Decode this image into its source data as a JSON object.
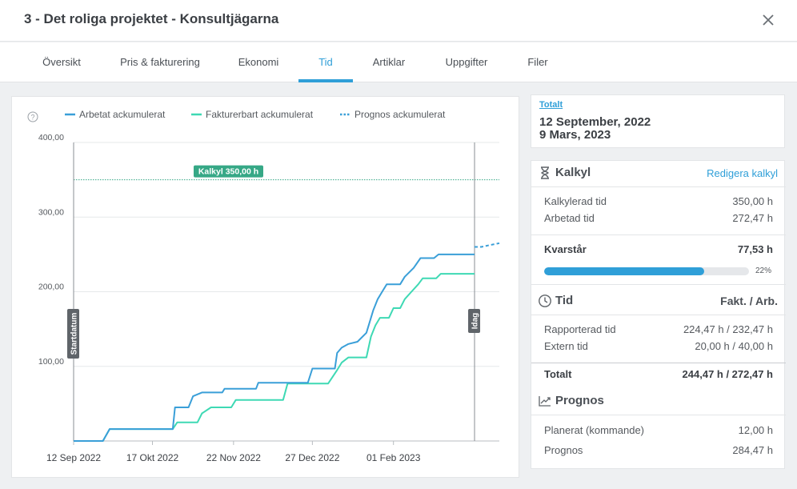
{
  "header": {
    "title": "3 - Det roliga projektet - Konsultjägarna"
  },
  "tabs": [
    {
      "label": "Översikt"
    },
    {
      "label": "Pris & fakturering"
    },
    {
      "label": "Ekonomi"
    },
    {
      "label": "Tid"
    },
    {
      "label": "Artiklar"
    },
    {
      "label": "Uppgifter"
    },
    {
      "label": "Filer"
    }
  ],
  "active_tab": "Tid",
  "summary": {
    "link": "Totalt",
    "start_date": "12 September, 2022",
    "end_date": "9 Mars, 2023"
  },
  "kalkyl": {
    "title": "Kalkyl",
    "edit_link": "Redigera kalkyl",
    "rows": [
      {
        "label": "Kalkylerad tid",
        "value": "350,00 h"
      },
      {
        "label": "Arbetad tid",
        "value": "272,47 h"
      }
    ],
    "remaining": {
      "label": "Kvarstår",
      "value": "77,53 h"
    },
    "progress_fraction": 0.78,
    "progress_label": "22%"
  },
  "tid": {
    "title": "Tid",
    "columns": "Fakt. / Arb.",
    "rows": [
      {
        "label": "Rapporterad tid",
        "value": "224,47 h / 232,47 h"
      },
      {
        "label": "Extern tid",
        "value": "20,00 h / 40,00 h"
      }
    ],
    "total": {
      "label": "Totalt",
      "value": "244,47 h / 272,47 h"
    }
  },
  "prognos": {
    "title": "Prognos",
    "rows": [
      {
        "label": "Planerat (kommande)",
        "value": "12,00 h"
      },
      {
        "label": "Prognos",
        "value": "284,47 h"
      }
    ]
  },
  "colors": {
    "accent": "#2f9fd8",
    "arbetat": "#3a9fd8",
    "fakturerbart": "#3ed9b4",
    "prognos": "#3a9fd8",
    "kalkyl": "#36a886"
  },
  "chart_data": {
    "type": "line",
    "legend": [
      {
        "name": "Arbetat ackumulerat",
        "style": "solid"
      },
      {
        "name": "Fakturerbart ackumulerat",
        "style": "solid"
      },
      {
        "name": "Prognos ackumulerat",
        "style": "dotted"
      }
    ],
    "ylim": [
      0,
      400
    ],
    "yticks": [
      "100,00",
      "200,00",
      "300,00",
      "400,00"
    ],
    "yvalues": [
      100,
      200,
      300,
      400
    ],
    "xlim": [
      "2022-09-12",
      "2023-03-20"
    ],
    "xticks": [
      {
        "label": "12 Sep 2022",
        "date": "2022-09-12"
      },
      {
        "label": "17 Okt 2022",
        "date": "2022-10-17"
      },
      {
        "label": "22 Nov 2022",
        "date": "2022-11-22"
      },
      {
        "label": "27 Dec 2022",
        "date": "2022-12-27"
      },
      {
        "label": "01 Feb 2023",
        "date": "2023-02-01"
      }
    ],
    "kalkyl_line": {
      "value": 350,
      "label": "Kalkyl 350,00 h"
    },
    "markers": [
      {
        "date": "2022-09-12",
        "label": "Startdatum"
      },
      {
        "date": "2023-03-09",
        "label": "Idag"
      }
    ],
    "series": [
      {
        "name": "Arbetat ackumulerat",
        "points": [
          [
            "2022-09-12",
            0
          ],
          [
            "2022-09-25",
            0
          ],
          [
            "2022-09-28",
            16
          ],
          [
            "2022-10-16",
            16
          ],
          [
            "2022-10-26",
            16
          ],
          [
            "2022-10-27",
            45
          ],
          [
            "2022-11-02",
            45
          ],
          [
            "2022-11-04",
            60
          ],
          [
            "2022-11-08",
            65
          ],
          [
            "2022-11-17",
            65
          ],
          [
            "2022-11-18",
            70
          ],
          [
            "2022-12-02",
            70
          ],
          [
            "2022-12-03",
            78
          ],
          [
            "2022-12-25",
            78
          ],
          [
            "2022-12-27",
            97
          ],
          [
            "2023-01-06",
            97
          ],
          [
            "2023-01-07",
            118
          ],
          [
            "2023-01-09",
            125
          ],
          [
            "2023-01-12",
            130
          ],
          [
            "2023-01-16",
            133
          ],
          [
            "2023-01-20",
            145
          ],
          [
            "2023-01-22",
            165
          ],
          [
            "2023-01-23",
            175
          ],
          [
            "2023-01-25",
            190
          ],
          [
            "2023-01-27",
            200
          ],
          [
            "2023-01-29",
            210
          ],
          [
            "2023-02-04",
            210
          ],
          [
            "2023-02-06",
            220
          ],
          [
            "2023-02-10",
            232
          ],
          [
            "2023-02-13",
            245
          ],
          [
            "2023-02-19",
            245
          ],
          [
            "2023-02-21",
            250
          ],
          [
            "2023-03-09",
            250
          ]
        ]
      },
      {
        "name": "Fakturerbart ackumulerat",
        "points": [
          [
            "2022-09-12",
            0
          ],
          [
            "2022-09-25",
            0
          ],
          [
            "2022-09-28",
            16
          ],
          [
            "2022-10-26",
            16
          ],
          [
            "2022-10-28",
            25
          ],
          [
            "2022-11-06",
            25
          ],
          [
            "2022-11-08",
            37
          ],
          [
            "2022-11-12",
            45
          ],
          [
            "2022-11-21",
            45
          ],
          [
            "2022-11-23",
            55
          ],
          [
            "2022-12-14",
            55
          ],
          [
            "2022-12-16",
            77
          ],
          [
            "2023-01-03",
            77
          ],
          [
            "2023-01-07",
            95
          ],
          [
            "2023-01-09",
            105
          ],
          [
            "2023-01-12",
            112
          ],
          [
            "2023-01-20",
            112
          ],
          [
            "2023-01-22",
            140
          ],
          [
            "2023-01-24",
            155
          ],
          [
            "2023-01-26",
            165
          ],
          [
            "2023-01-30",
            165
          ],
          [
            "2023-02-01",
            178
          ],
          [
            "2023-02-04",
            178
          ],
          [
            "2023-02-06",
            190
          ],
          [
            "2023-02-09",
            200
          ],
          [
            "2023-02-12",
            210
          ],
          [
            "2023-02-14",
            218
          ],
          [
            "2023-02-20",
            218
          ],
          [
            "2023-02-22",
            224
          ],
          [
            "2023-03-09",
            224
          ]
        ]
      },
      {
        "name": "Prognos ackumulerat",
        "points": [
          [
            "2023-03-09",
            260
          ],
          [
            "2023-03-12",
            260
          ],
          [
            "2023-03-15",
            262
          ],
          [
            "2023-03-20",
            265
          ]
        ]
      }
    ]
  }
}
